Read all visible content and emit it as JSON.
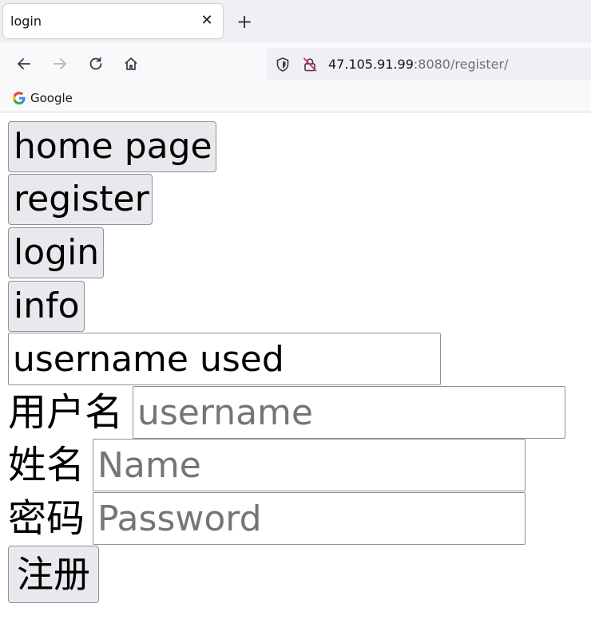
{
  "browser": {
    "tab_title": "login",
    "close_tab_glyph": "✕",
    "new_tab_glyph": "+",
    "url_host": "47.105.91.99",
    "url_rest": ":8080/register/",
    "bookmark_label": "Google",
    "icons": [
      "back-icon",
      "forward-icon",
      "reload-icon",
      "home-icon",
      "shield-icon",
      "insecure-lock-icon",
      "google-logo-icon"
    ]
  },
  "page": {
    "nav_buttons": {
      "home": "home page",
      "register": "register",
      "login": "login",
      "info": "info"
    },
    "status_field_value": "username used",
    "form": {
      "username_label": "用户名",
      "username_placeholder": "username",
      "name_label": "姓名",
      "name_placeholder": "Name",
      "password_label": "密码",
      "password_placeholder": "Password",
      "submit_label": "注册"
    }
  }
}
